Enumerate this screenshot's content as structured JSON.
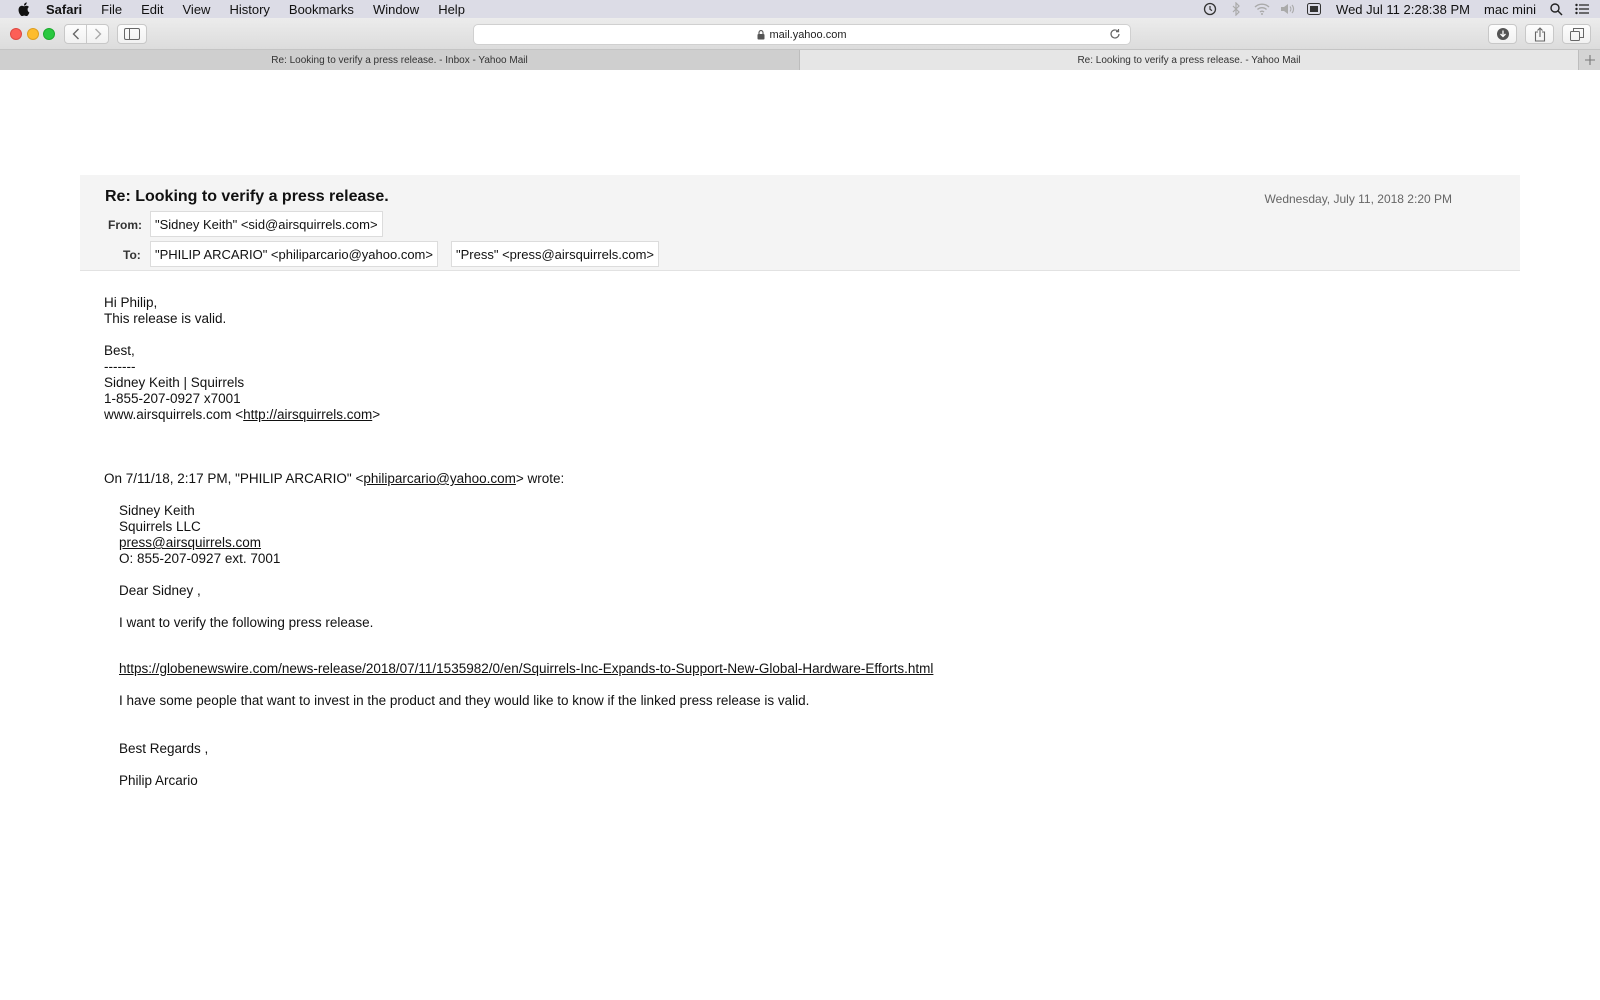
{
  "menubar": {
    "app_name": "Safari",
    "items": [
      "File",
      "Edit",
      "View",
      "History",
      "Bookmarks",
      "Window",
      "Help"
    ],
    "clock": "Wed Jul 11  2:28:38 PM",
    "user": "mac mini"
  },
  "toolbar": {
    "address": "mail.yahoo.com"
  },
  "tabs": [
    {
      "label": "Re: Looking to verify a press release. - Inbox - Yahoo Mail",
      "active": false
    },
    {
      "label": "Re: Looking to verify a press release. - Yahoo Mail",
      "active": true
    }
  ],
  "email": {
    "subject": "Re: Looking to verify a press release.",
    "date": "Wednesday, July 11, 2018 2:20 PM",
    "from_label": "From:",
    "to_label": "To:",
    "from": "\"Sidney Keith\" <sid@airsquirrels.com>",
    "to": [
      "\"PHILIP ARCARIO\" <philiparcario@yahoo.com>",
      "\"Press\" <press@airsquirrels.com>"
    ],
    "body": {
      "greeting": "Hi Philip,",
      "message": "This release is valid.",
      "closing": "Best,",
      "dashes": "-------",
      "sig_name": "Sidney Keith | Squirrels",
      "sig_phone": "1-855-207-0927 x7001",
      "sig_site_prefix": "www.airsquirrels.com <",
      "sig_site_link": "http://airsquirrels.com",
      "sig_site_suffix": ">",
      "quote_header_prefix": "On 7/11/18, 2:17 PM, \"PHILIP ARCARIO\" <",
      "quote_header_link": "philiparcario@yahoo.com",
      "quote_header_suffix": "> wrote:",
      "quote": {
        "name": "Sidney Keith",
        "company": "Squirrels LLC",
        "email": "press@airsquirrels.com",
        "phone": "O: 855-207-0927 ext. 7001",
        "salutation": "Dear Sidney ,",
        "line1": "I want to verify the following press release.",
        "url": "https://globenewswire.com/news-release/2018/07/11/1535982/0/en/Squirrels-Inc-Expands-to-Support-New-Global-Hardware-Efforts.html",
        "line2": "I have some people that want to invest in the product and they would like to know if the linked press release is valid.",
        "regards": "Best Regards ,",
        "signature": "Philip Arcario"
      }
    }
  }
}
